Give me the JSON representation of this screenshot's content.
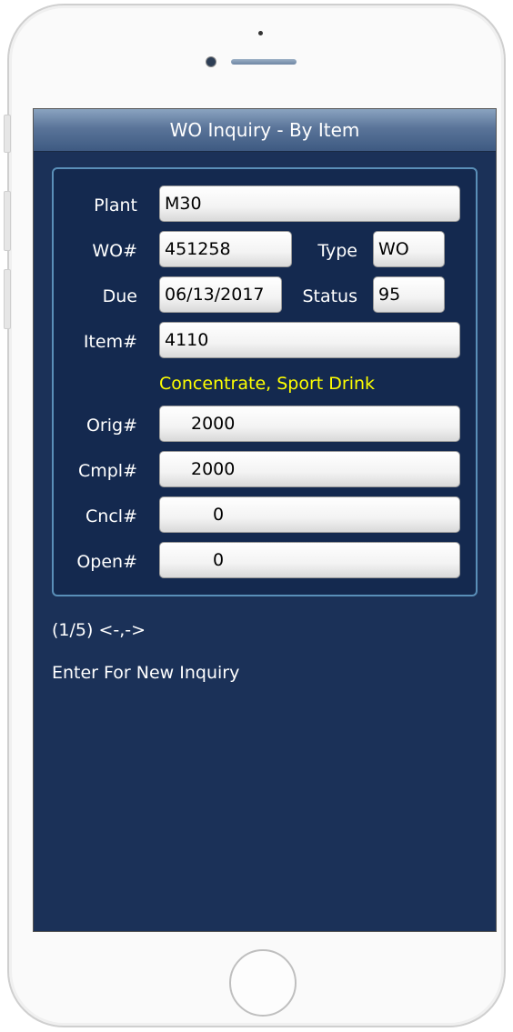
{
  "screen": {
    "title": "WO Inquiry - By Item"
  },
  "form": {
    "plant_label": "Plant",
    "plant_value": "M30",
    "wo_label": "WO#",
    "wo_value": "451258",
    "type_label": "Type",
    "type_value": "WO",
    "due_label": "Due",
    "due_value": "06/13/2017",
    "status_label": "Status",
    "status_value": "95",
    "item_label": "Item#",
    "item_value": "4110",
    "item_description": "Concentrate, Sport Drink",
    "orig_label": "Orig#",
    "orig_value": "2000",
    "cmpl_label": "Cmpl#",
    "cmpl_value": "2000",
    "cncl_label": "Cncl#",
    "cncl_value": "0",
    "open_label": "Open#",
    "open_value": "0"
  },
  "footer": {
    "pager": "(1/5) <-,->",
    "hint": "Enter For New Inquiry"
  },
  "colors": {
    "screen_bg": "#1b3158",
    "description_text": "#ffff00",
    "panel_border": "#5a8fb8"
  }
}
